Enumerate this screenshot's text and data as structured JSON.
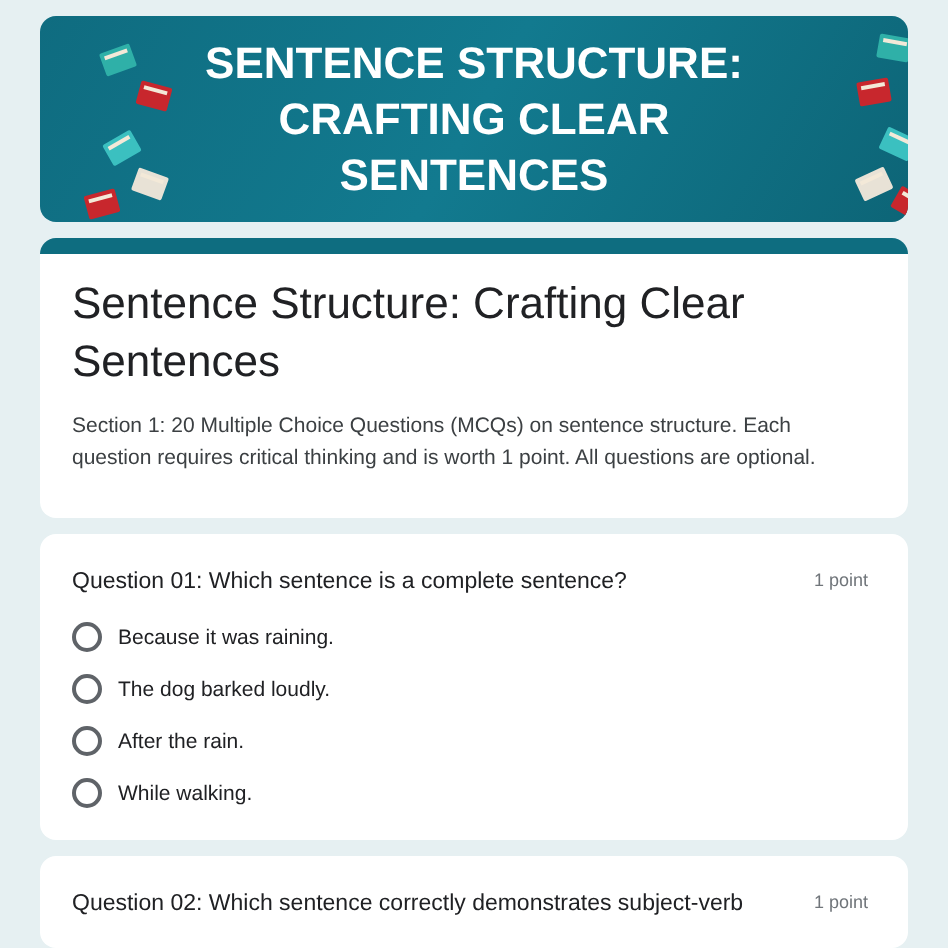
{
  "banner": {
    "title": "SENTENCE STRUCTURE: CRAFTING CLEAR SENTENCES"
  },
  "header": {
    "title": "Sentence Structure: Crafting Clear Sentences",
    "description": "Section 1: 20 Multiple Choice Questions (MCQs) on sentence structure. Each question requires critical thinking and is worth 1 point. All questions are optional."
  },
  "questions": [
    {
      "text": "Question 01: Which sentence is a complete sentence?",
      "points": "1 point",
      "options": [
        {
          "label": "Because it was raining.",
          "selected": false
        },
        {
          "label": "The dog barked loudly.",
          "selected": false
        },
        {
          "label": "After the rain.",
          "selected": false
        },
        {
          "label": "While walking.",
          "selected": false
        }
      ]
    },
    {
      "text": "Question 02: Which sentence correctly demonstrates subject-verb",
      "points": "1 point"
    }
  ]
}
